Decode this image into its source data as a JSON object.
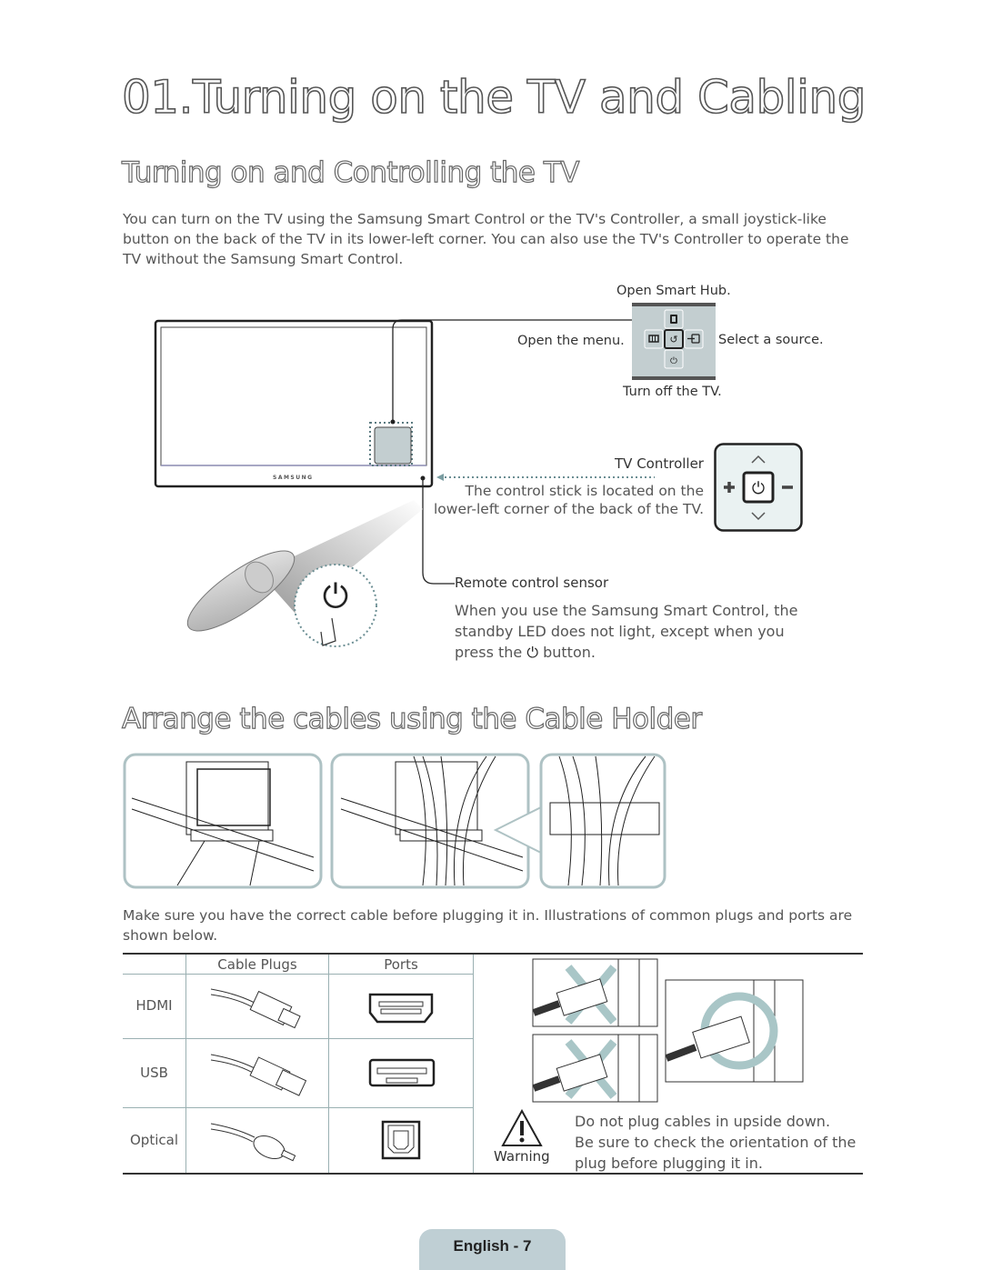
{
  "page": {
    "title": "01.Turning on the TV and Cabling",
    "footer": "English - 7"
  },
  "section1": {
    "heading": "Turning on and Controlling the TV",
    "intro": "You can turn on the TV using the Samsung Smart Control or the TV's Controller, a small joystick-like button on the back of the TV in its lower-left corner. You can also use the TV's Controller to operate the TV without the Samsung Smart Control.",
    "tv_brand": "SAMSUNG",
    "controller_menu": {
      "up": "Open Smart Hub.",
      "left": "Open the menu.",
      "right": "Select a source.",
      "down": "Turn off the TV."
    },
    "tv_controller": {
      "title": "TV Controller",
      "description_line1": "The control stick is located on the",
      "description_line2": "lower-left corner of the back of the TV."
    },
    "remote_sensor": {
      "title": "Remote control sensor",
      "line1": "When you use the Samsung Smart Control, the",
      "line2": "standby LED does not light, except when you",
      "line3_before": "press the",
      "line3_after": "button."
    }
  },
  "section2": {
    "heading": "Arrange the cables using the Cable Holder"
  },
  "section3": {
    "intro": "Make sure you have the correct cable before plugging it in. Illustrations of common plugs and ports are shown below.",
    "table": {
      "headers": [
        "",
        "Cable Plugs",
        "Ports"
      ],
      "rows": [
        {
          "name": "HDMI",
          "plug_icon": "hdmi-plug-icon",
          "port_icon": "hdmi-port-icon"
        },
        {
          "name": "USB",
          "plug_icon": "usb-plug-icon",
          "port_icon": "usb-port-icon"
        },
        {
          "name": "Optical",
          "plug_icon": "optical-plug-icon",
          "port_icon": "optical-port-icon"
        }
      ]
    },
    "warning": {
      "label": "Warning",
      "line1": "Do not plug cables in upside down.",
      "line2": "Be sure to check the orientation of the",
      "line3": "plug before plugging it in."
    }
  },
  "colors": {
    "accent_light": "#bfcfd4",
    "panel_fill": "#c3ced0",
    "mark_fill": "#a9c6c7"
  }
}
